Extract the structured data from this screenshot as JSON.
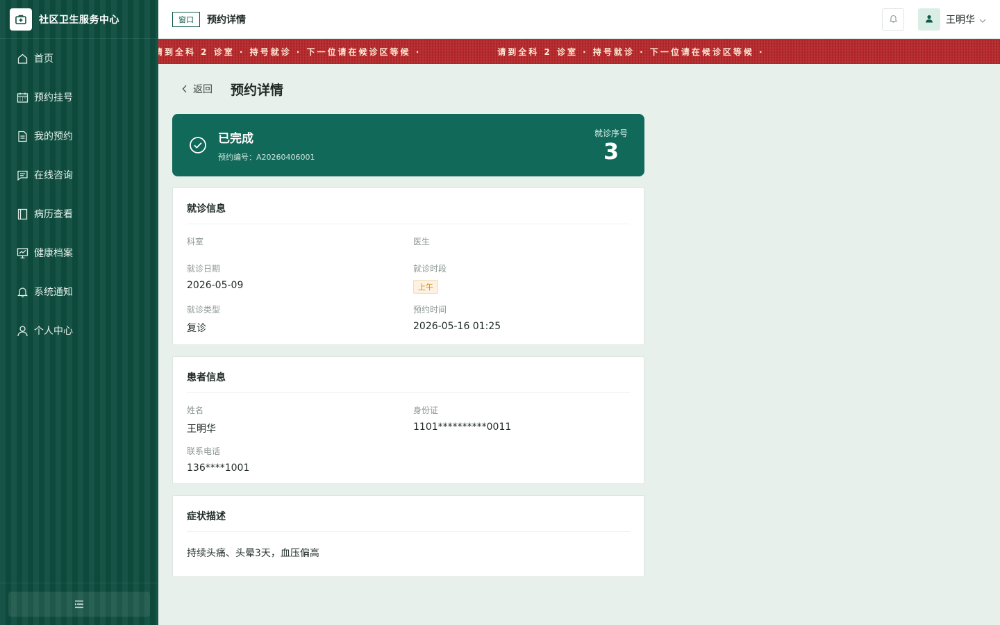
{
  "app": {
    "title": "社区卫生服务中心"
  },
  "sidebar": {
    "items": [
      {
        "label": "首页",
        "icon": "home-icon"
      },
      {
        "label": "预约挂号",
        "icon": "calendar-icon"
      },
      {
        "label": "我的预约",
        "icon": "document-icon"
      },
      {
        "label": "在线咨询",
        "icon": "chat-icon"
      },
      {
        "label": "病历查看",
        "icon": "book-icon"
      },
      {
        "label": "健康档案",
        "icon": "chart-board-icon"
      },
      {
        "label": "系统通知",
        "icon": "bell-icon"
      },
      {
        "label": "个人中心",
        "icon": "user-icon"
      }
    ]
  },
  "topbar": {
    "tag": "窗口",
    "title": "预约详情",
    "user": "王明华"
  },
  "ticker": {
    "text": "请到全科 2 诊室  ·  持号就诊  ·  下一位请在候诊区等候  ·  "
  },
  "page": {
    "back_label": "返回",
    "title": "预约详情"
  },
  "status": {
    "text": "已完成",
    "appointment_no_label": "预约编号：",
    "appointment_no": "A20260406001",
    "queue_label": "就诊序号",
    "queue_number": "3"
  },
  "visit_info": {
    "title": "就诊信息",
    "department_label": "科室",
    "department": "",
    "doctor_label": "医生",
    "doctor": "",
    "date_label": "就诊日期",
    "date": "2026-05-09",
    "period_label": "就诊时段",
    "period": "上午",
    "type_label": "就诊类型",
    "type": "复诊",
    "booked_label": "预约时间",
    "booked": "2026-05-16 01:25"
  },
  "patient_info": {
    "title": "患者信息",
    "name_label": "姓名",
    "name": "王明华",
    "id_label": "身份证",
    "id": "1101**********0011",
    "phone_label": "联系电话",
    "phone": "136****1001"
  },
  "symptoms": {
    "title": "症状描述",
    "text": "持续头痛、头晕3天，血压偏高"
  },
  "colors": {
    "primary": "#11695a",
    "sidebar": "#0f4e40",
    "ticker": "#b8272a",
    "am_badge": "#d98b1c"
  }
}
